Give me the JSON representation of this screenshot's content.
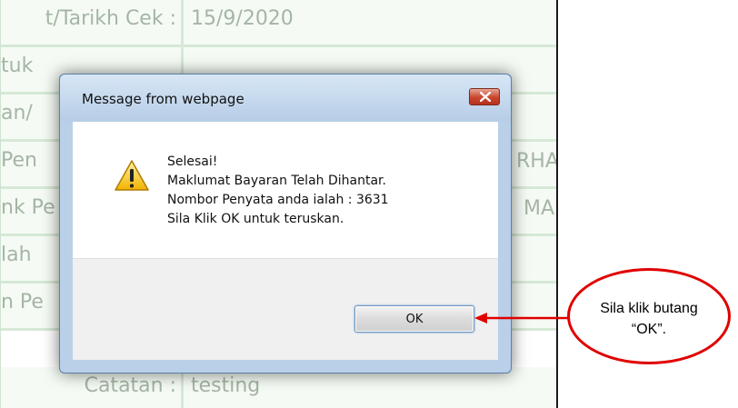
{
  "background_form": {
    "rows": [
      {
        "label": "t/Tarikh Cek :",
        "value": "15/9/2020"
      },
      {
        "label": "tuk",
        "value": ""
      },
      {
        "label": "an/",
        "value": ""
      },
      {
        "label": "Pen",
        "value": "",
        "value_right": "RHA"
      },
      {
        "label": "nk Pe",
        "value": "",
        "value_right": "MA"
      },
      {
        "label": "lah",
        "value": ""
      },
      {
        "label": "n Pe",
        "value": ""
      },
      {
        "label": "Catatan :",
        "value": "testing"
      }
    ]
  },
  "dialog": {
    "title": "Message from webpage",
    "close_icon": "close-icon",
    "message_lines": [
      "Selesai!",
      "Maklumat Bayaran Telah Dihantar.",
      "Nombor Penyata anda ialah : 3631",
      "Sila Klik OK untuk teruskan."
    ],
    "ok_label": "OK",
    "icon": "warning-icon"
  },
  "annotation": {
    "line1": "Sila klik butang",
    "line2": "“OK”.",
    "color": "#e00000"
  }
}
